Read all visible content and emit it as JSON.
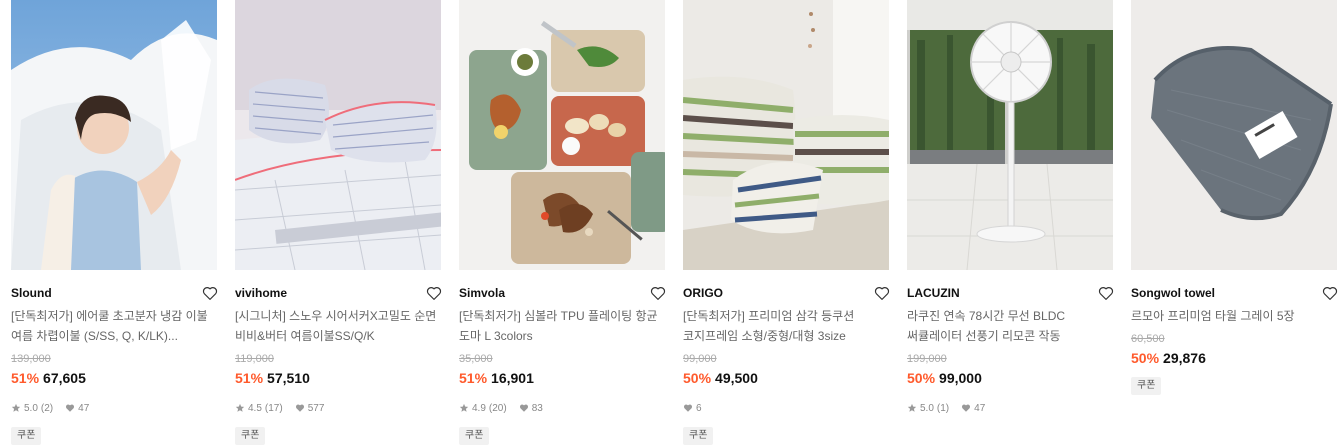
{
  "products": [
    {
      "brand": "Slound",
      "name": "[단독최저가] 에어쿨 초고분자 냉감 이불 여름 차렵이불 (S/SS, Q, K/LK)...",
      "original_price": "139,000",
      "discount": "51%",
      "price": "67,605",
      "rating": "5.0",
      "reviews": "(2)",
      "likes": "47",
      "badge": "쿠폰"
    },
    {
      "brand": "vivihome",
      "name": "[시그니처] 스노우 시어서커X고밀도 순면 비비&버터 여름이불SS/Q/K",
      "original_price": "119,000",
      "discount": "51%",
      "price": "57,510",
      "rating": "4.5",
      "reviews": "(17)",
      "likes": "577",
      "badge": "쿠폰"
    },
    {
      "brand": "Simvola",
      "name": "[단독최저가] 심볼라 TPU 플레이팅 항균 도마 L 3colors",
      "original_price": "35,000",
      "discount": "51%",
      "price": "16,901",
      "rating": "4.9",
      "reviews": "(20)",
      "likes": "83",
      "badge": "쿠폰"
    },
    {
      "brand": "ORIGO",
      "name": "[단독최저가] 프리미엄 삼각 등쿠션 코지프레임 소형/중형/대형 3size",
      "original_price": "99,000",
      "discount": "50%",
      "price": "49,500",
      "rating": "",
      "reviews": "",
      "likes": "6",
      "badge": "쿠폰"
    },
    {
      "brand": "LACUZIN",
      "name": "라쿠진 연속 78시간 무선 BLDC 써큘레이터 선풍기 리모콘 작동",
      "original_price": "199,000",
      "discount": "50%",
      "price": "99,000",
      "rating": "5.0",
      "reviews": "(1)",
      "likes": "47",
      "badge": ""
    },
    {
      "brand": "Songwol towel",
      "name": "르모아 프리미엄 타월 그레이 5장",
      "original_price": "60,500",
      "discount": "50%",
      "price": "29,876",
      "rating": "",
      "reviews": "",
      "likes": "",
      "badge": "쿠폰"
    }
  ],
  "icons": {
    "wishlist": "heart-outline-icon",
    "rating": "star-icon",
    "likes": "heart-filled-icon"
  },
  "colors": {
    "discount": "#ff5a2c",
    "meta": "#888888",
    "badge_bg": "#f1f1f1"
  }
}
